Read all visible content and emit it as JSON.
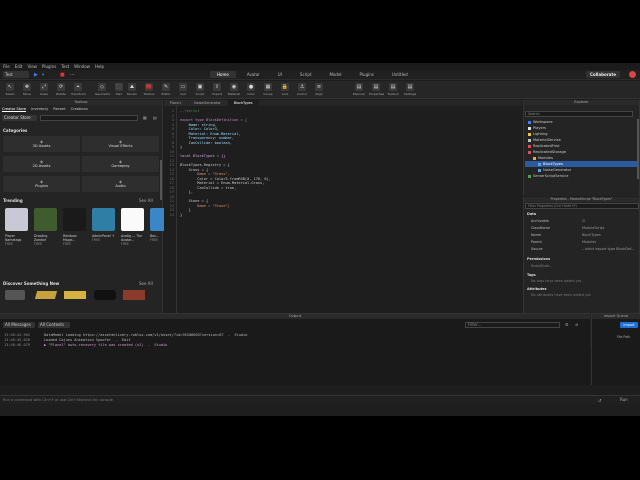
{
  "menu": [
    "File",
    "Edit",
    "View",
    "Plugins",
    "Test",
    "Window",
    "Help"
  ],
  "ribbon": {
    "test_dropdown": "Test",
    "tabs": [
      "Home",
      "Avatar",
      "UI",
      "Script",
      "Model",
      "Plugins",
      "Untitled"
    ],
    "collaborate": "Collaborate"
  },
  "tools": [
    "Select",
    "Move",
    "Scale",
    "Rotate",
    "Transform",
    "Geometric",
    "Part",
    "Terrain",
    "Toolbox",
    "Editor",
    "GUI",
    "Script",
    "Import",
    "Material",
    "Color",
    "Group",
    "Lock",
    "Anchor",
    "Align"
  ],
  "tools_right": [
    "Explorer",
    "Properties",
    "Toolbox",
    "Settings"
  ],
  "toolbox": {
    "title": "Toolbox",
    "tab_store": "Creator Store",
    "tab_inventory": "Inventory",
    "tab_recent": "Recent",
    "tab_creations": "Creations",
    "store_dropdown": "Creator Store",
    "search_placeholder": "Search",
    "categories_heading": "Categories",
    "categories": [
      "3D Assets",
      "Visual Effects",
      "2D Assets",
      "Gameplay",
      "Plugins",
      "Audio"
    ],
    "trending_heading": "Trending",
    "see_all": "See All",
    "trending": [
      {
        "name": "Player Nametags",
        "price": "FREE",
        "color": "#c9c9d6"
      },
      {
        "name": "Drooling Zombie",
        "price": "FREE",
        "color": "#3e5c2e"
      },
      {
        "name": "Rainbow Magic...",
        "price": "FREE",
        "color": "#1a1a1a"
      },
      {
        "name": "AdminPanel +",
        "price": "FREE",
        "color": "#2f7ea6"
      },
      {
        "name": "Avatig — The Avatar...",
        "price": "FREE",
        "color": "#fafafa"
      },
      {
        "name": "Bas...",
        "price": "FREE",
        "color": "#3b86c6"
      }
    ],
    "discover_heading": "Discover Something New",
    "see_all_2": "See All"
  },
  "editor": {
    "tabs": [
      "Place1",
      "NoiseGenerator",
      "BlockTypes"
    ],
    "lines": [
      {
        "n": "1",
        "t": "--!strict",
        "c": "#5a8a5a"
      },
      {
        "n": "2",
        "t": "",
        "c": "#ccc"
      },
      {
        "n": "3",
        "t": "export type BlockDefinition = {",
        "c": "#c586c0"
      },
      {
        "n": "4",
        "t": "    Name: string,",
        "c": "#9cdcfe"
      },
      {
        "n": "5",
        "t": "    Color: Color3,",
        "c": "#9cdcfe"
      },
      {
        "n": "6",
        "t": "    Material: Enum.Material,",
        "c": "#9cdcfe"
      },
      {
        "n": "7",
        "t": "    Transparency: number,",
        "c": "#9cdcfe"
      },
      {
        "n": "8",
        "t": "    CanCollide: boolean,",
        "c": "#9cdcfe"
      },
      {
        "n": "9",
        "t": "}",
        "c": "#ccc"
      },
      {
        "n": "10",
        "t": "",
        "c": "#ccc"
      },
      {
        "n": "11",
        "t": "local BlockTypes = {}",
        "c": "#d7a3e6"
      },
      {
        "n": "12",
        "t": "",
        "c": "#ccc"
      },
      {
        "n": "13",
        "t": "BlockTypes.Registry = {",
        "c": "#cccccc"
      },
      {
        "n": "14",
        "t": "    Grass = {",
        "c": "#cccccc"
      },
      {
        "n": "15",
        "t": "        Name = \"Grass\",",
        "c": "#ce9178"
      },
      {
        "n": "16",
        "t": "        Color = Color3.fromRGB(0, 170, 0),",
        "c": "#cccccc"
      },
      {
        "n": "17",
        "t": "        Material = Enum.Material.Grass,",
        "c": "#cccccc"
      },
      {
        "n": "18",
        "t": "        CanCollide = true,",
        "c": "#cccccc"
      },
      {
        "n": "19",
        "t": "    },",
        "c": "#cccccc"
      },
      {
        "n": "20",
        "t": "",
        "c": "#ccc"
      },
      {
        "n": "21",
        "t": "    Stone = {",
        "c": "#cccccc"
      },
      {
        "n": "22",
        "t": "        Name = \"Stone\"|",
        "c": "#ce9178"
      },
      {
        "n": "23",
        "t": "    }",
        "c": "#cccccc"
      },
      {
        "n": "24",
        "t": "}",
        "c": "#cccccc"
      }
    ]
  },
  "explorer": {
    "title": "Explorer",
    "filter_placeholder": "Search",
    "items": [
      {
        "label": "Workspace",
        "indent": 0,
        "icon": "#3b82f6"
      },
      {
        "label": "Players",
        "indent": 0,
        "icon": "#e0e0e0"
      },
      {
        "label": "Lighting",
        "indent": 0,
        "icon": "#f0c040"
      },
      {
        "label": "MaterialService",
        "indent": 0,
        "icon": "#c0c0c0"
      },
      {
        "label": "ReplicatedFirst",
        "indent": 0,
        "icon": "#e05050"
      },
      {
        "label": "ReplicatedStorage",
        "indent": 0,
        "icon": "#e05050"
      },
      {
        "label": "Modules",
        "indent": 1,
        "icon": "#e0b040"
      },
      {
        "label": "BlockTypes",
        "indent": 2,
        "icon": "#5aa0e0",
        "selected": true
      },
      {
        "label": "NoiseGenerator",
        "indent": 2,
        "icon": "#5aa0e0"
      },
      {
        "label": "ServerScriptService",
        "indent": 0,
        "icon": "#50a050"
      }
    ]
  },
  "properties": {
    "title": "Properties - ModuleScript \"BlockTypes\"",
    "filter_placeholder": "Filter Properties (Ctrl+Shift+P)",
    "sections": [
      "Data",
      "Permissions",
      "Tags",
      "Attributes"
    ],
    "rows": [
      {
        "k": "Archivable",
        "v": "☑"
      },
      {
        "k": "ClassName",
        "v": "ModuleScript"
      },
      {
        "k": "Name",
        "v": "BlockTypes"
      },
      {
        "k": "Parent",
        "v": "Modules"
      },
      {
        "k": "Source",
        "v": "--!strict export type BlockDef..."
      }
    ],
    "perm_row": "ScriptGuid...",
    "tags_text": "No tags have been added yet.",
    "attrs_text": "No attributes have been added yet."
  },
  "output": {
    "title": "Output",
    "filter_all": "All Messages",
    "filter_ctx": "All Contexts",
    "filter_placeholder": "Filter...",
    "lines": [
      {
        "time": "13:48:44.902",
        "text": "DataModel Loading https://assetdelivery.roblox.com/v1/asset/?id=95206603?version=67  -  Studio",
        "color": "#bbbbbb"
      },
      {
        "time": "13:48:45.020",
        "text": "Loaded Cajuns Animation Spoofer  -  Edit",
        "color": "#bbbbbb"
      },
      {
        "time": "13:48:46.079",
        "text": "▶ \"Place1\" auto-recovery file was created (x2)  -  Studio",
        "color": "#d69ad6"
      }
    ]
  },
  "import_queue": {
    "title": "Import Queue",
    "import_button": "Import",
    "file_path": "File Path"
  },
  "command_bar": {
    "placeholder": "Run a command with Ctrl+F or use Ctrl+Shortcut for console",
    "run_label": "Run"
  },
  "colors": {
    "accent": "#1e6fd6",
    "selection": "#2c5aa0",
    "bg": "#1e1e1e",
    "panel": "#242424"
  }
}
